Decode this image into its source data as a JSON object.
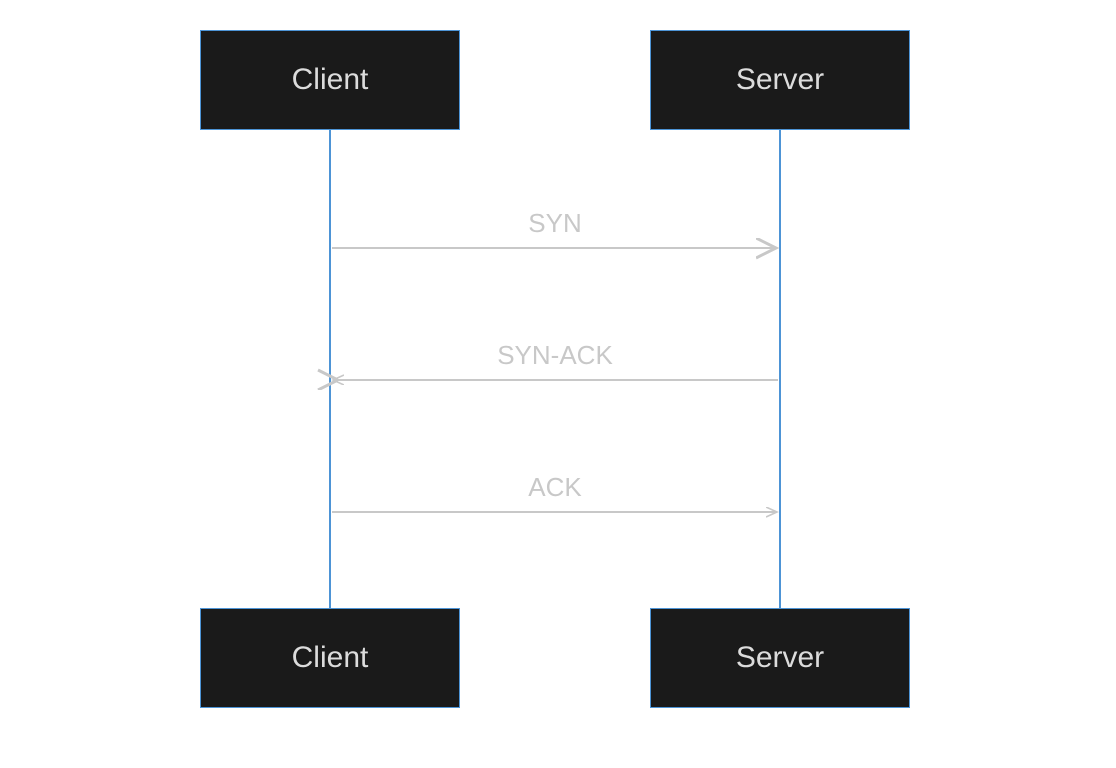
{
  "diagram": {
    "type": "sequence",
    "actors": {
      "left": "Client",
      "right": "Server"
    },
    "messages": [
      {
        "label": "SYN",
        "from": "left",
        "to": "right"
      },
      {
        "label": "SYN-ACK",
        "from": "right",
        "to": "left"
      },
      {
        "label": "ACK",
        "from": "left",
        "to": "right"
      }
    ],
    "colors": {
      "box_fill": "#1a1a1a",
      "box_border": "#4d94d6",
      "box_text": "#dcdcdc",
      "lifeline": "#4d94d6",
      "arrow": "#c8c8c8",
      "msg_text": "#c8c8c8"
    }
  }
}
